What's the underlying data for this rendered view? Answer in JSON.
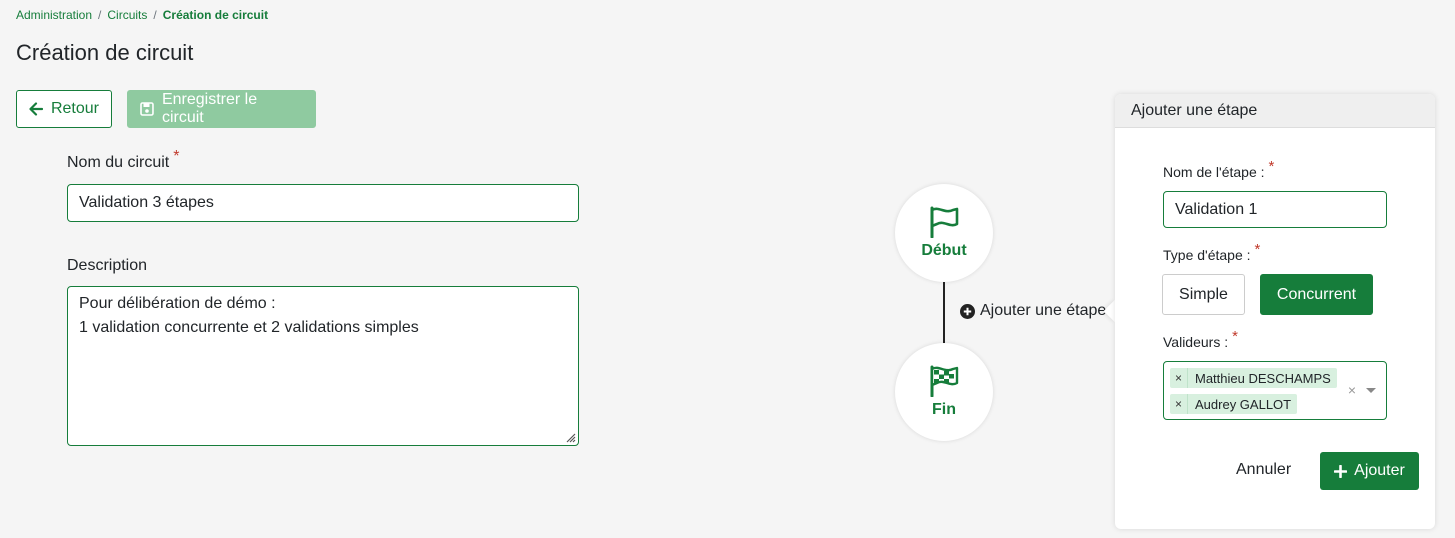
{
  "breadcrumb": {
    "items": [
      "Administration",
      "Circuits"
    ],
    "current": "Création de circuit",
    "separator": "/"
  },
  "page": {
    "title": "Création de circuit"
  },
  "toolbar": {
    "back_label": "Retour",
    "save_label": "Enregistrer le circuit"
  },
  "form": {
    "name_label": "Nom du circuit",
    "name_value": "Validation 3 étapes",
    "description_label": "Description",
    "description_lines": [
      "Pour délibération de démo :",
      "1 validation concurrente et 2 validations simples"
    ],
    "required_mark": "*"
  },
  "circuit": {
    "start_label": "Début",
    "end_label": "Fin",
    "add_step_label": "Ajouter une étape",
    "start_icon": "flag-icon",
    "end_icon": "checkered-flag-icon"
  },
  "panel": {
    "title": "Ajouter une étape",
    "step_name_label": "Nom de l'étape :",
    "step_name_value": "Validation 1",
    "step_type_label": "Type d'étape :",
    "type_options": [
      "Simple",
      "Concurrent"
    ],
    "selected_type": "Concurrent",
    "validators_label": "Valideurs :",
    "validators": [
      "Matthieu DESCHAMPS",
      "Audrey GALLOT"
    ],
    "clear_symbol": "×",
    "cancel_label": "Annuler",
    "add_label": "Ajouter"
  },
  "colors": {
    "primary": "#167d3b",
    "primary_disabled": "#8fcaa0",
    "tag_bg": "#d8f0df",
    "required": "#c0392b"
  }
}
